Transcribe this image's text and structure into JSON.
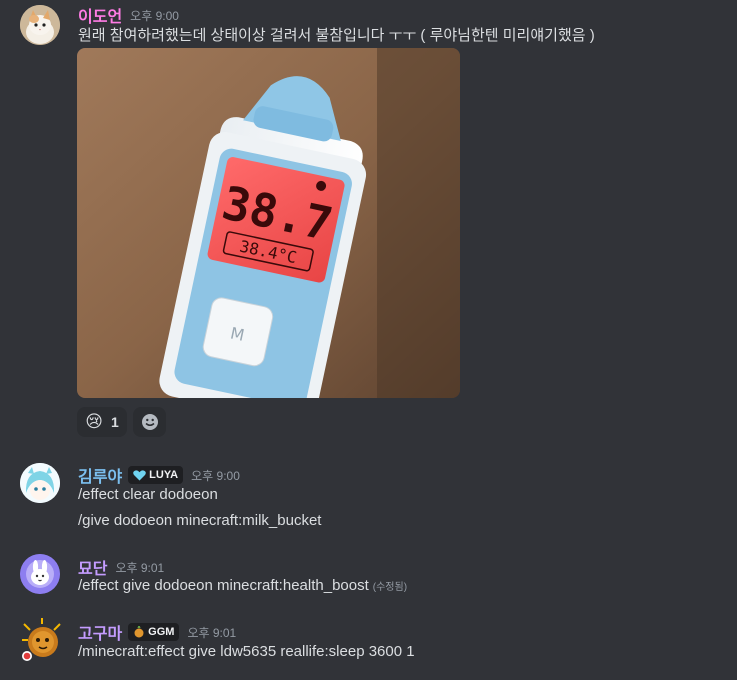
{
  "messages": [
    {
      "username": "이도언",
      "username_color": "#ff7ce5",
      "timestamp": "오후 9:00",
      "lines": [
        "원래 참여하려했는데 상태이상 걸려서 불참입니다 ㅜㅜ ( 루야님한텐 미리얘기했음 )"
      ],
      "image": {
        "display_reading": "38.7",
        "sub_reading": "38.4°C",
        "button_letter": "M"
      },
      "reactions": [
        {
          "emoji": "😢",
          "count": "1"
        }
      ]
    },
    {
      "username": "김루야",
      "username_color": "#7cc0f0",
      "tag_text": "LUYA",
      "timestamp": "오후 9:00",
      "lines": [
        "/effect clear dodoeon",
        "/give dodoeon minecraft:milk_bucket"
      ]
    },
    {
      "username": "묘단",
      "username_color": "#c49cff",
      "timestamp": "오후 9:01",
      "lines": [
        "/effect give dodoeon minecraft:health_boost"
      ],
      "edited_label": "(수정됨)"
    },
    {
      "username": "고구마",
      "username_color": "#c49cff",
      "tag_text": "GGM",
      "timestamp": "오후 9:01",
      "lines": [
        "/minecraft:effect give ldw5635 reallife:sleep 3600 1"
      ]
    }
  ],
  "colors": {
    "background": "#313338",
    "text": "#dbdee1",
    "muted": "#949ba4"
  }
}
